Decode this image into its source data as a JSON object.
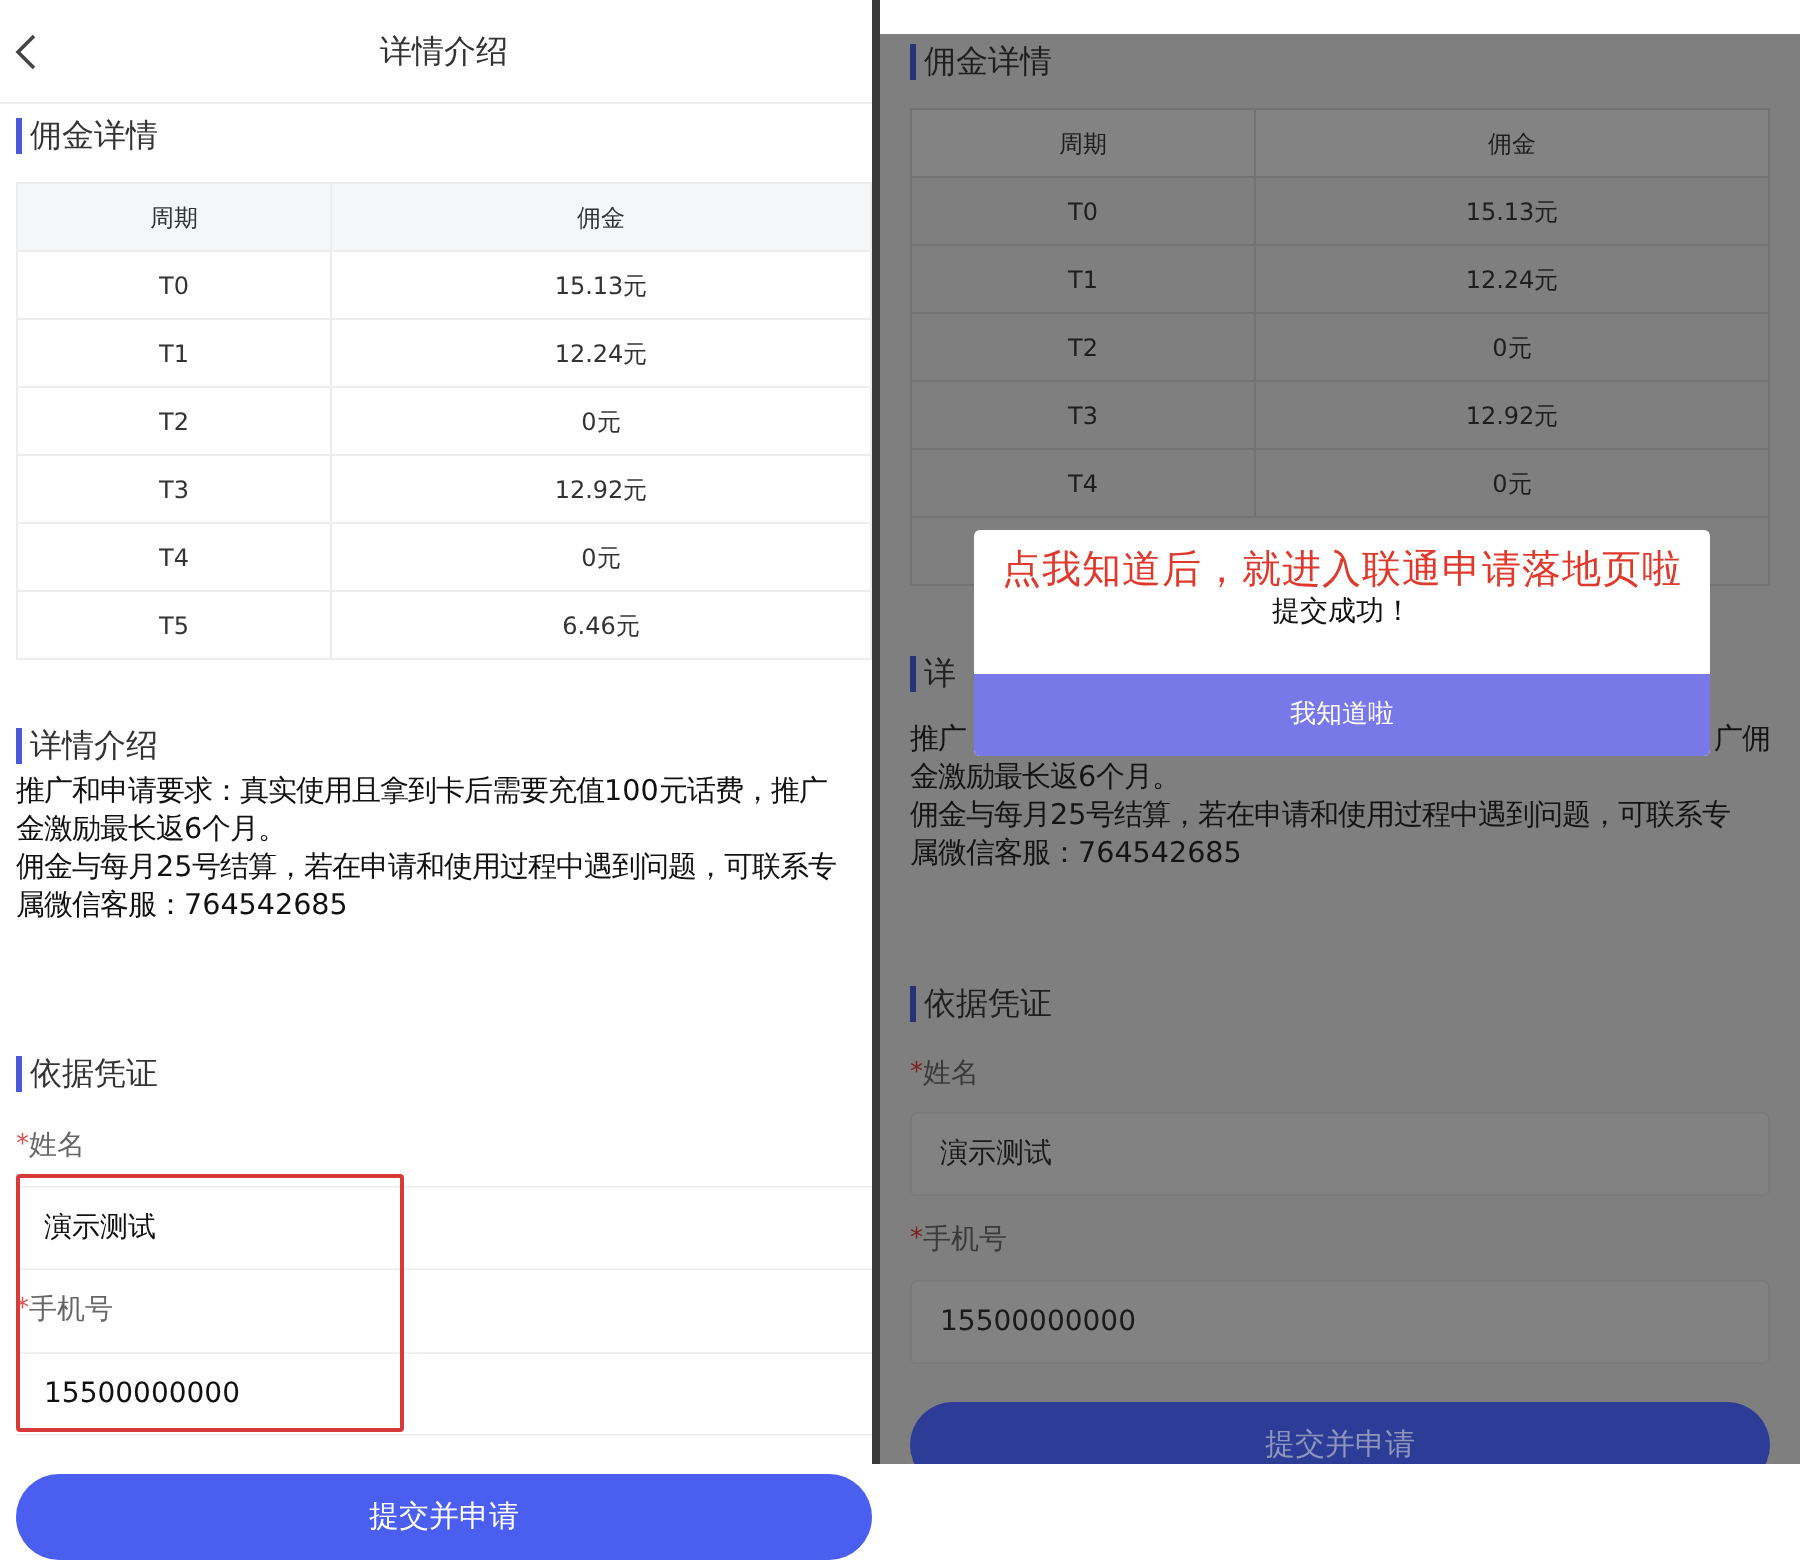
{
  "screens": [
    {
      "dimmed": false,
      "header": {
        "title": "详情介绍"
      },
      "commission": {
        "heading": "佣金详情",
        "columns": [
          "周期",
          "佣金"
        ],
        "rows": [
          [
            "T0",
            "15.13元"
          ],
          [
            "T1",
            "12.24元"
          ],
          [
            "T2",
            "0元"
          ],
          [
            "T3",
            "12.92元"
          ],
          [
            "T4",
            "0元"
          ],
          [
            "T5",
            "6.46元"
          ]
        ]
      },
      "intro": {
        "heading": "详情介绍",
        "lines": [
          [
            "推广和申请要求：真实使用且拿到卡后需要充值100元话费，推广"
          ],
          [
            "金激励最长返6个月。"
          ],
          [
            "佣金与每月25号结算，若在申请和使用过程中遇到问题，可联系专"
          ],
          [
            "属微信客服：764542685"
          ]
        ]
      },
      "form": {
        "heading": "依据凭证",
        "fields": [
          {
            "required_mark": "*",
            "label": "姓名",
            "value": "演示测试"
          },
          {
            "required_mark": "*",
            "label": "手机号",
            "value": "15500000000"
          }
        ],
        "submit": "提交并申请"
      }
    },
    {
      "dimmed": true,
      "commission": {
        "heading": "佣金详情",
        "columns": [
          "周期",
          "佣金"
        ],
        "rows": [
          [
            "T0",
            "15.13元"
          ],
          [
            "T1",
            "12.24元"
          ],
          [
            "T2",
            "0元"
          ],
          [
            "T3",
            "12.92元"
          ],
          [
            "T4",
            "0元"
          ]
        ]
      },
      "intro": {
        "heading": "详",
        "lines": [
          [
            "推广",
            "广佣"
          ],
          [
            "金激励最长返6个月。"
          ],
          [
            "佣金与每月25号结算，若在申请和使用过程中遇到问题，可联系专"
          ],
          [
            "属微信客服：764542685"
          ]
        ]
      },
      "form": {
        "heading": "依据凭证",
        "fields": [
          {
            "required_mark": "*",
            "label": "姓名",
            "value": "演示测试"
          },
          {
            "required_mark": "*",
            "label": "手机号",
            "value": "15500000000"
          }
        ],
        "submit": "提交并申请"
      },
      "dialog": {
        "note": "点我知道后，就进入联通申请落地页啦",
        "message": "提交成功！",
        "button": "我知道啦"
      }
    }
  ]
}
